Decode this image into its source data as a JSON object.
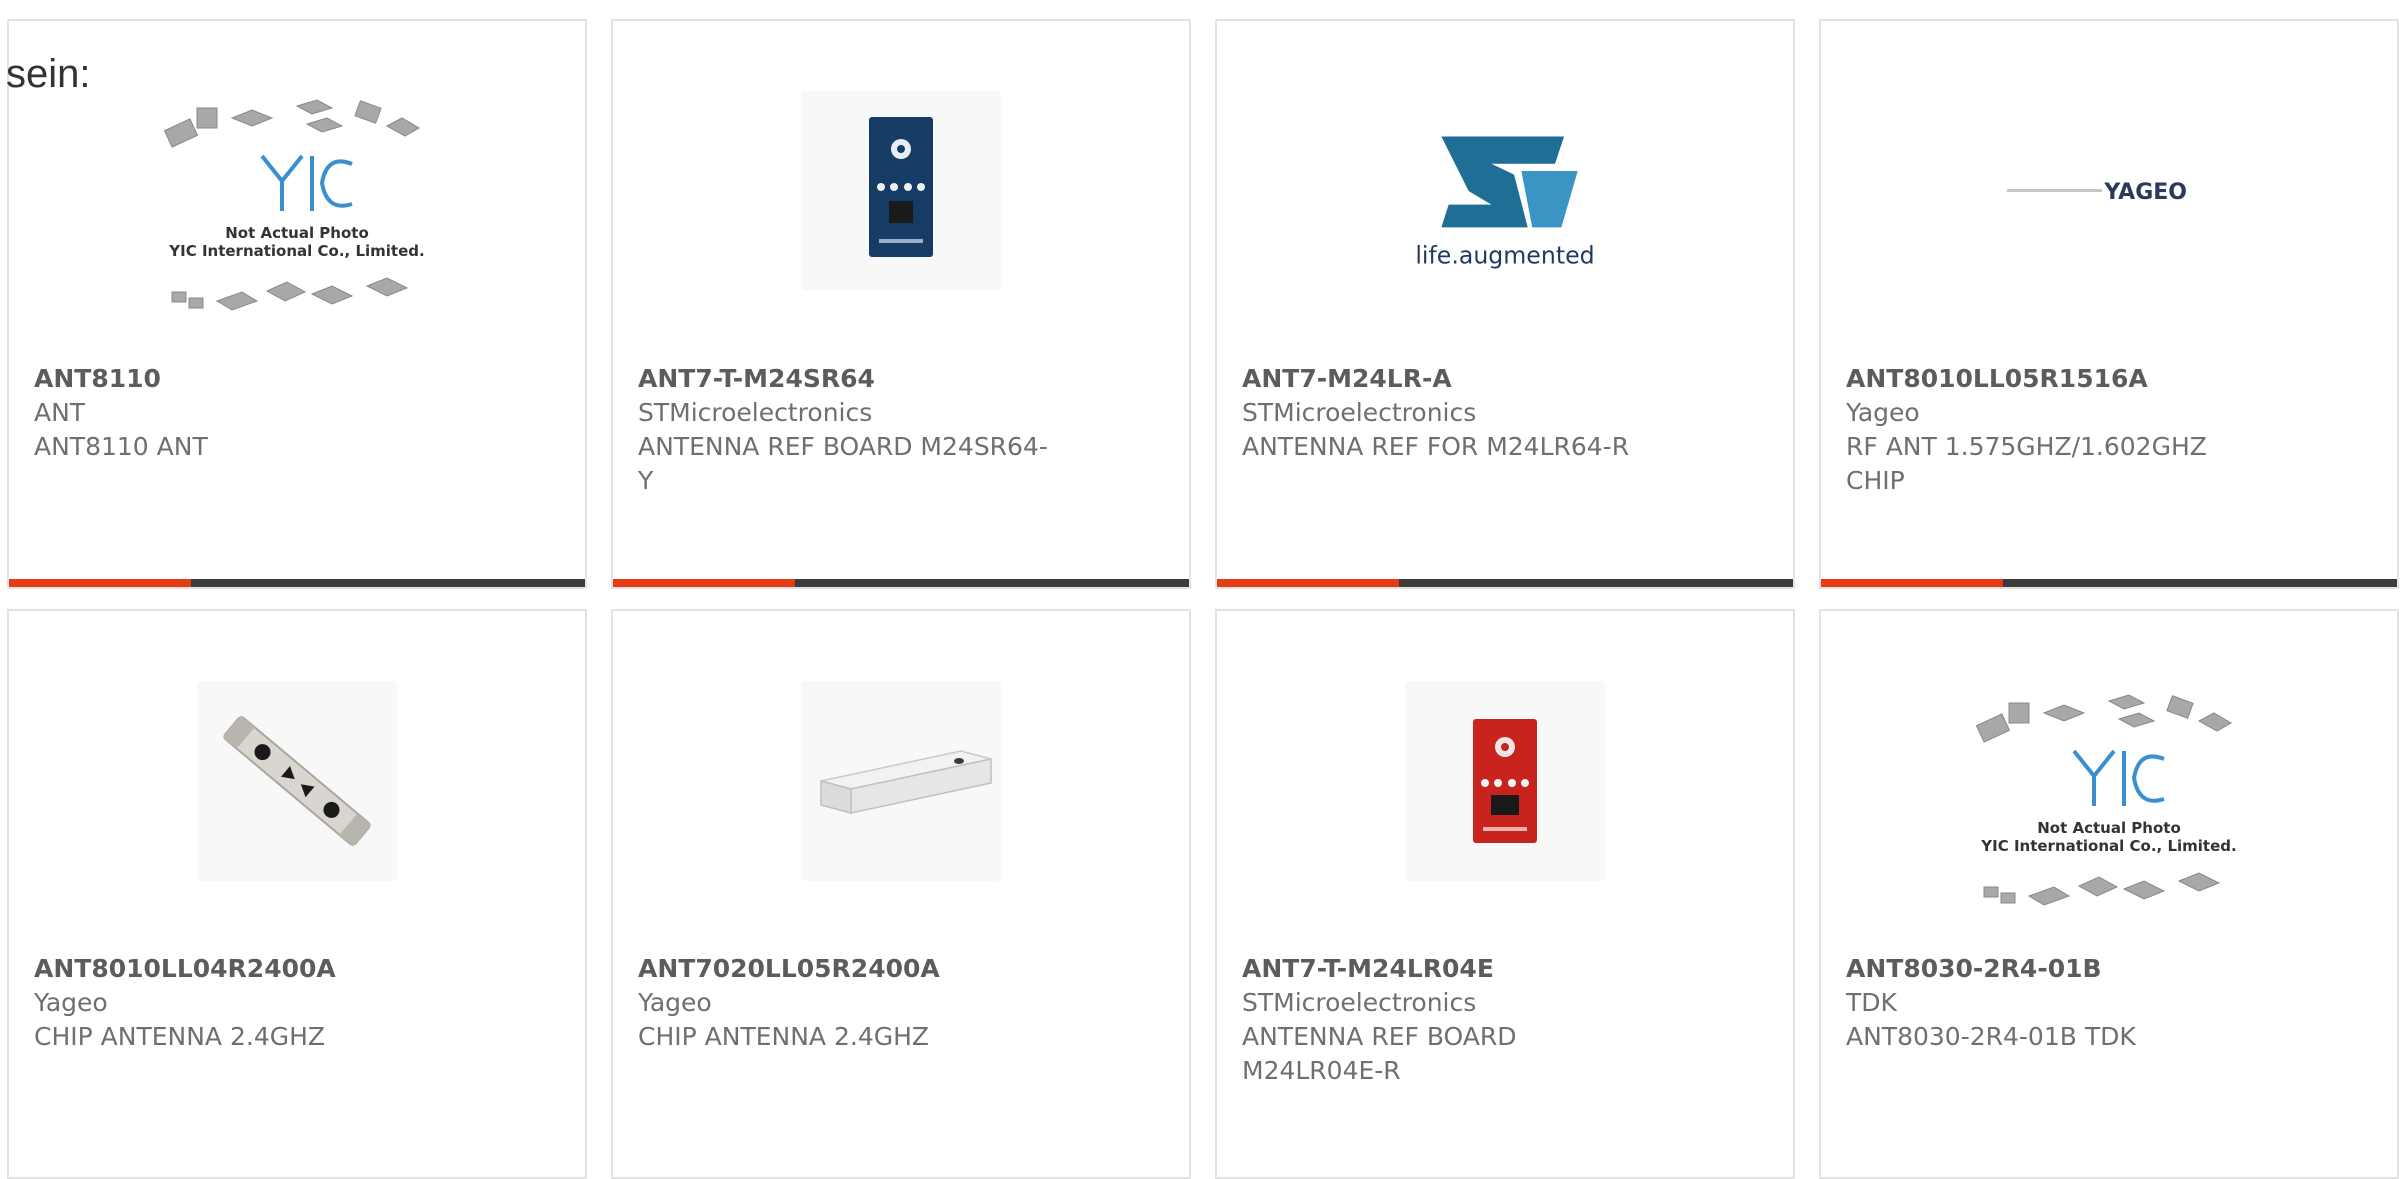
{
  "lead_text": "sein:",
  "products": [
    {
      "part_number": "ANT8110",
      "manufacturer": "ANT",
      "description": "ANT8110 ANT",
      "image": "placeholder",
      "placeholder_line1": "Not Actual Photo",
      "placeholder_line2": "YIC International Co., Limited."
    },
    {
      "part_number": "ANT7-T-M24SR64",
      "manufacturer": "STMicroelectronics",
      "description": "ANTENNA REF BOARD M24SR64-Y",
      "image": "blue-board"
    },
    {
      "part_number": "ANT7-M24LR-A",
      "manufacturer": "STMicroelectronics",
      "description": "ANTENNA REF FOR M24LR64-R",
      "image": "st-logo",
      "logo_tagline": "life.augmented"
    },
    {
      "part_number": "ANT8010LL05R1516A",
      "manufacturer": "Yageo",
      "description": "RF ANT 1.575GHZ/1.602GHZ CHIP",
      "image": "yageo-logo",
      "logo_text": "YAGEO"
    },
    {
      "part_number": "ANT8010LL04R2400A",
      "manufacturer": "Yageo",
      "description": "CHIP ANTENNA 2.4GHZ",
      "image": "chip-antenna-rod"
    },
    {
      "part_number": "ANT7020LL05R2400A",
      "manufacturer": "Yageo",
      "description": "CHIP ANTENNA 2.4GHZ",
      "image": "chip-antenna-block"
    },
    {
      "part_number": "ANT7-T-M24LR04E",
      "manufacturer": "STMicroelectronics",
      "description": "ANTENNA REF BOARD M24LR04E-R",
      "image": "red-board"
    },
    {
      "part_number": "ANT8030-2R4-01B",
      "manufacturer": "TDK",
      "description": "ANT8030-2R4-01B TDK",
      "image": "placeholder",
      "placeholder_line1": "Not Actual Photo",
      "placeholder_line2": "YIC International Co., Limited."
    }
  ],
  "colors": {
    "accent": "#e63c16",
    "bar": "#3c3c3c",
    "border": "#e3e3e3"
  }
}
